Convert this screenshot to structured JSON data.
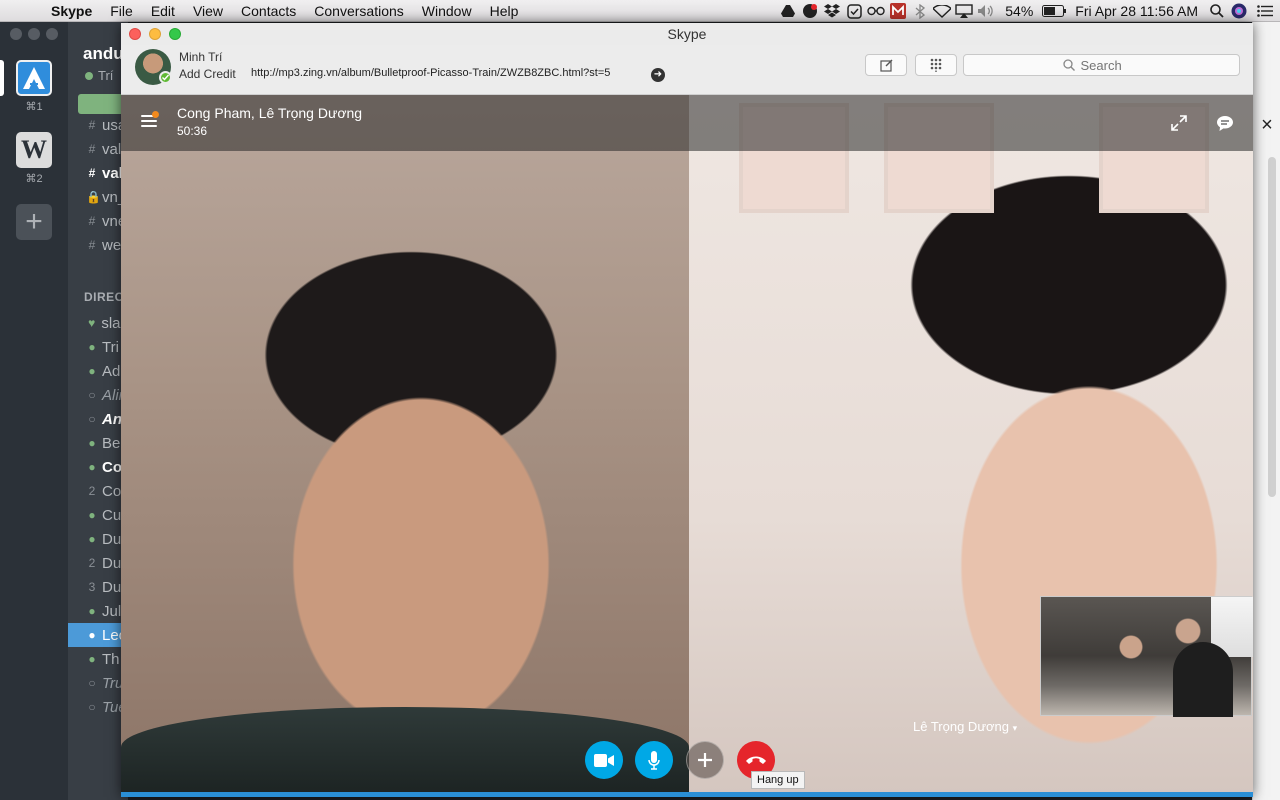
{
  "menubar": {
    "apple": "",
    "items": [
      "Skype",
      "File",
      "Edit",
      "View",
      "Contacts",
      "Conversations",
      "Window",
      "Help"
    ],
    "battery": "54%",
    "datetime": "Fri Apr 28  11:56 AM"
  },
  "slack": {
    "team_name": "andu",
    "me": "Trí",
    "shortcut_1": "⌘1",
    "shortcut_2": "⌘2",
    "team2_letter": "W",
    "add_team": "+",
    "channels": [
      {
        "mark": "#",
        "label": "usa"
      },
      {
        "mark": "#",
        "label": "val"
      },
      {
        "mark": "#",
        "label": "val"
      },
      {
        "mark": "🔒",
        "label": "vn_"
      },
      {
        "mark": "#",
        "label": "vne"
      },
      {
        "mark": "#",
        "label": "we"
      }
    ],
    "direct_header": "DIREC",
    "dms": [
      {
        "mark": "♥",
        "label": "slac"
      },
      {
        "mark": "●",
        "label": "Tri"
      },
      {
        "mark": "●",
        "label": "Ad"
      },
      {
        "mark": "○",
        "label": "Alir"
      },
      {
        "mark": "○",
        "label": "An"
      },
      {
        "mark": "●",
        "label": "Be"
      },
      {
        "mark": "●",
        "label": "Co"
      },
      {
        "mark": "2",
        "label": "Co"
      },
      {
        "mark": "●",
        "label": "Cu"
      },
      {
        "mark": "●",
        "label": "Du"
      },
      {
        "mark": "2",
        "label": "Du"
      },
      {
        "mark": "3",
        "label": "Du"
      },
      {
        "mark": "●",
        "label": "Jul"
      },
      {
        "mark": "●",
        "label": "Leo"
      },
      {
        "mark": "●",
        "label": "Th"
      },
      {
        "mark": "○",
        "label": "Tru"
      },
      {
        "mark": "○",
        "label": "Tue"
      }
    ]
  },
  "skype": {
    "window_title": "Skype",
    "profile": {
      "name": "Minh Trí",
      "add_credit": "Add Credit",
      "mood_url": "http://mp3.zing.vn/album/Bulletproof-Picasso-Train/ZWZB8ZBC.html?st=5"
    },
    "search": {
      "placeholder": "Search"
    },
    "call": {
      "participants": "Cong Pham, Lê Trọng Dương",
      "timer": "50:36",
      "remote_name": "Lê Trọng Dương",
      "hangup_tooltip": "Hang up"
    },
    "colors": {
      "skype_blue": "#00a8e6",
      "hangup_red": "#e5252b",
      "presence_green": "#5fba34",
      "notification_orange": "#f28a1e"
    }
  }
}
